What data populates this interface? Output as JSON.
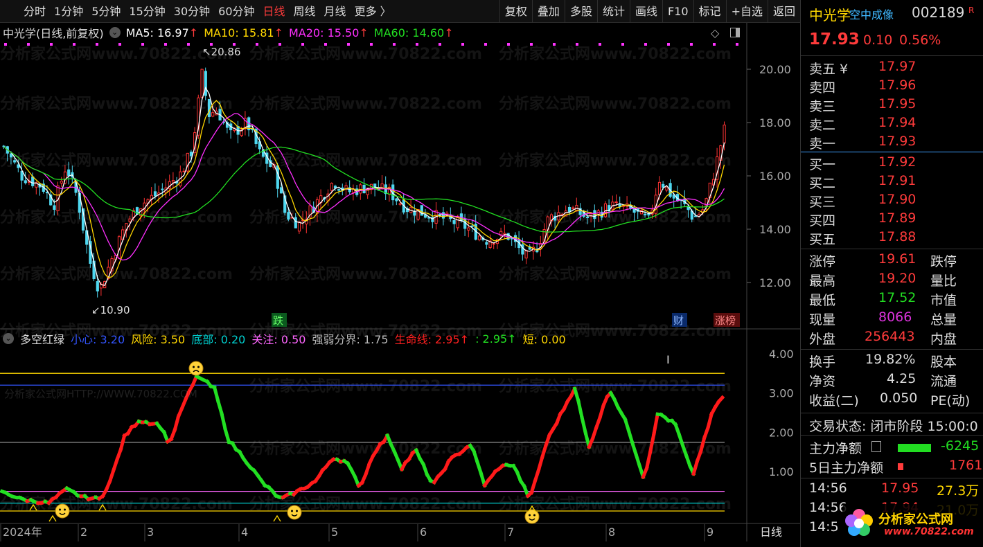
{
  "toolbar": {
    "periods": [
      "分时",
      "1分钟",
      "5分钟",
      "15分钟",
      "30分钟",
      "60分钟",
      "日线",
      "周线",
      "月线",
      "更多 〉"
    ],
    "active_period": "日线",
    "actions": [
      "复权",
      "叠加",
      "多股",
      "统计",
      "画线",
      "F10",
      "标记",
      "+自选",
      "返回"
    ]
  },
  "main_chart": {
    "title": "中光学(日线,前复权)",
    "ma": [
      {
        "label": "MA5: 16.97",
        "arrow": "↑",
        "color": "#ffffff"
      },
      {
        "label": "MA10: 15.81",
        "arrow": "↑",
        "color": "#ffd700"
      },
      {
        "label": "MA20: 15.50",
        "arrow": "↑",
        "color": "#ff2fff"
      },
      {
        "label": "MA60: 14.60",
        "arrow": "↑",
        "color": "#22e022"
      }
    ],
    "y_ticks": [
      "20.00",
      "18.00",
      "16.00",
      "14.00",
      "12.00"
    ],
    "high_marker": "20.86",
    "low_marker": "10.90",
    "tags": {
      "drop": "跌",
      "finance": "财",
      "rank": "涨榜"
    }
  },
  "indicator": {
    "name": "多空红绿",
    "params": [
      {
        "label": "小心: 3.20",
        "color": "#3355ff"
      },
      {
        "label": "风险: 3.50",
        "color": "#ffd700"
      },
      {
        "label": "底部: 0.20",
        "color": "#00d0d0"
      },
      {
        "label": "关注: 0.50",
        "color": "#ff66ff"
      },
      {
        "label": "强弱分界: 1.75",
        "color": "#bbbbbb"
      },
      {
        "label": "生命线: 2.95↑",
        "color": "#ff2020"
      },
      {
        "label": ": 2.95↑",
        "color": "#22dd22"
      },
      {
        "label": "短: 0.00",
        "color": "#ffd700"
      }
    ],
    "y_ticks": [
      "4.00",
      "3.00",
      "2.00",
      "1.00"
    ],
    "url_watermark": "分析家公式网HTTP://WWW.70822.COM"
  },
  "x_axis": {
    "labels": [
      "2024年",
      "2",
      "3",
      "4",
      "5",
      "6",
      "7",
      "8",
      "9"
    ],
    "period_label": "日线"
  },
  "watermark": "分析家公式网www.70822.com",
  "quote": {
    "name": "中光学",
    "sub": "空中成像",
    "code": "002189",
    "flag": "R",
    "price": "17.93",
    "change": "0.10",
    "pct": "0.56%",
    "asks": [
      {
        "label": "卖五 ¥",
        "price": "17.97"
      },
      {
        "label": "卖四",
        "price": "17.96"
      },
      {
        "label": "卖三",
        "price": "17.95"
      },
      {
        "label": "卖二",
        "price": "17.94"
      },
      {
        "label": "卖一",
        "price": "17.93"
      }
    ],
    "bids": [
      {
        "label": "买一",
        "price": "17.92"
      },
      {
        "label": "买二",
        "price": "17.91"
      },
      {
        "label": "买三",
        "price": "17.90"
      },
      {
        "label": "买四",
        "price": "17.89"
      },
      {
        "label": "买五",
        "price": "17.88"
      }
    ],
    "stats": [
      {
        "l": "涨停",
        "v": "19.61",
        "c": "跌停",
        "vc": "#ff3b3b"
      },
      {
        "l": "最高",
        "v": "19.20",
        "c": "量比",
        "vc": "#ff3b3b"
      },
      {
        "l": "最低",
        "v": "17.52",
        "c": "市值",
        "vc": "#22dd22"
      },
      {
        "l": "现量",
        "v": "8066",
        "c": "总量",
        "vc": "#dd33dd"
      },
      {
        "l": "外盘",
        "v": "256443",
        "c": "内盘",
        "vc": "#ff3b3b"
      }
    ],
    "stats2": [
      {
        "l": "换手",
        "v": "19.82%",
        "c": "股本"
      },
      {
        "l": "净资",
        "v": "4.25",
        "c": "流通"
      },
      {
        "l": "收益(二)",
        "v": "0.050",
        "c": "PE(动)"
      }
    ],
    "status_label": "交易状态: 闭市阶段 15:00:0",
    "flow": [
      {
        "l": "主力净额",
        "v": "-6245",
        "color": "#22dd22"
      },
      {
        "l": "5日主力净额",
        "v": "1761",
        "color": "#ff3b3b"
      }
    ],
    "ticks": [
      {
        "t": "14:56",
        "p": "17.95",
        "v": "27.3万"
      },
      {
        "t": "14:56",
        "p": "17.94",
        "v": "21.0万"
      },
      {
        "t": "14:5",
        "p": "",
        "v": ""
      }
    ],
    "logo": "分析家公式网",
    "logo_url": "www.70822.com"
  }
}
